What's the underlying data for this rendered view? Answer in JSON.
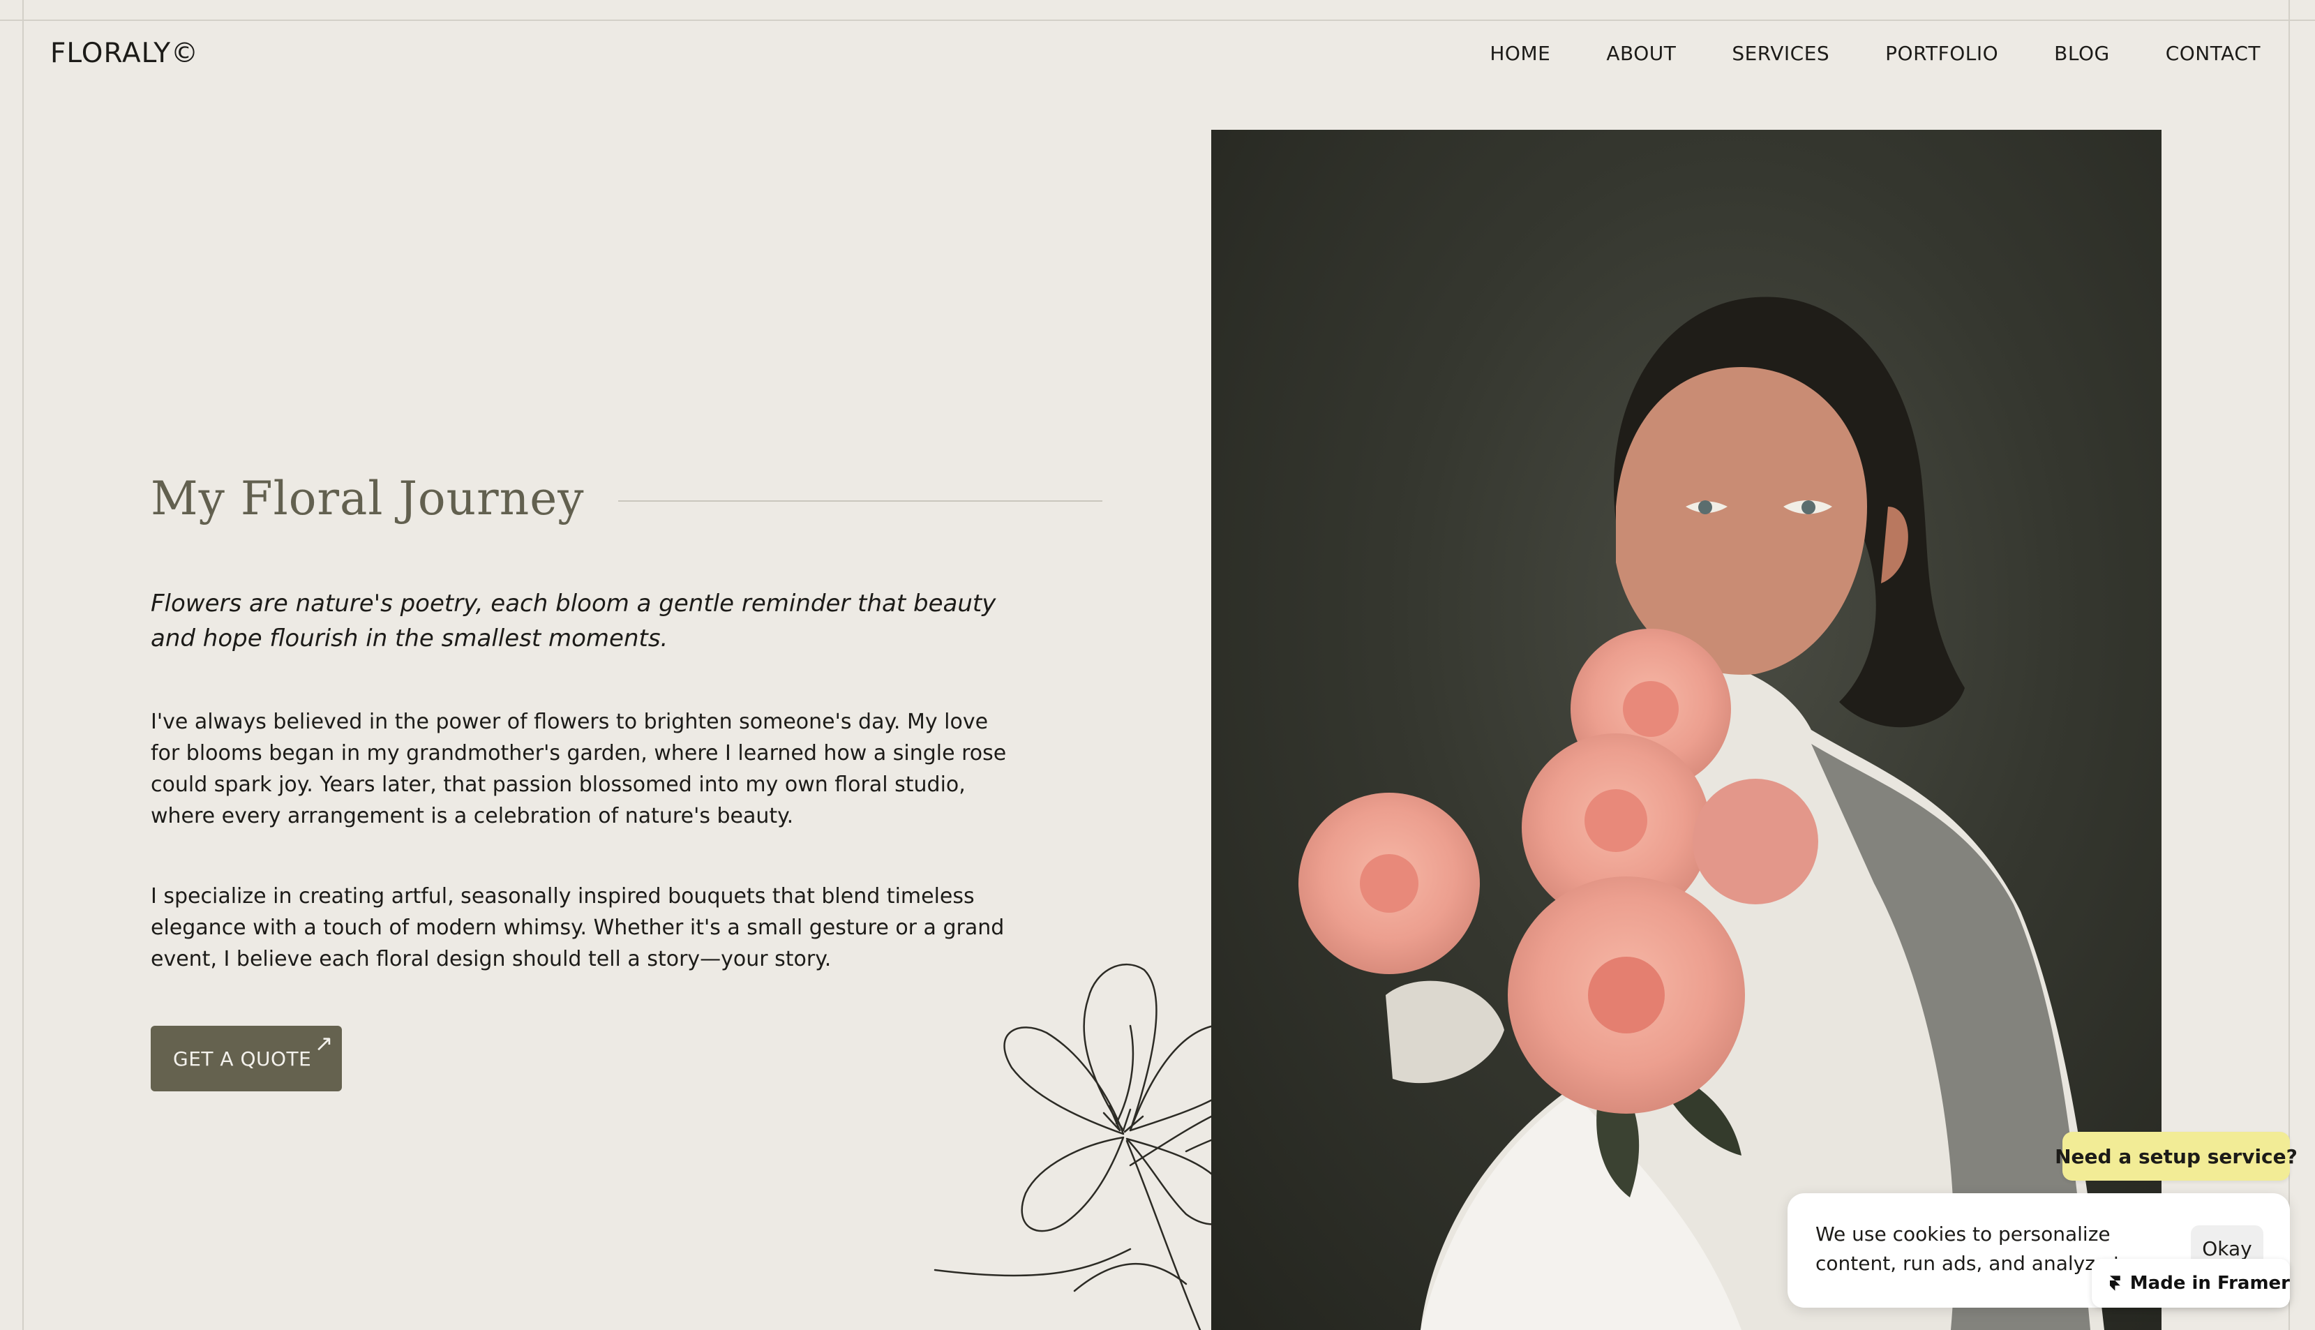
{
  "site": {
    "logo": "FLORALY©"
  },
  "nav": {
    "items": [
      {
        "label": "HOME"
      },
      {
        "label": "ABOUT"
      },
      {
        "label": "SERVICES"
      },
      {
        "label": "PORTFOLIO"
      },
      {
        "label": "BLOG"
      },
      {
        "label": "CONTACT"
      }
    ]
  },
  "hero": {
    "title": "My Floral Journey",
    "quote": "Flowers are nature's poetry, each bloom a gentle reminder that beauty and hope flourish in the smallest moments.",
    "paragraph1": "I've always believed in the power of flowers to brighten someone's day. My love for blooms began in my grandmother's garden, where I learned how a single rose could spark joy. Years later, that passion blossomed into my own floral studio, where every arrangement is a celebration of nature's beauty.",
    "paragraph2": "I specialize in creating artful, seasonally inspired bouquets that blend timeless elegance with a touch of modern whimsy. Whether it's a small gesture or a grand event, I believe each floral design should tell a story—your story.",
    "cta_label": "GET A QUOTE",
    "cta_icon": "arrow-up-right-icon"
  },
  "widgets": {
    "setup_label": "Need a setup service?",
    "cookie_text": "We use cookies to personalize content, run ads, and analyze t",
    "okay_label": "Okay",
    "framer_label": "Made in Framer"
  },
  "colors": {
    "background": "#edeae4",
    "title": "#62604f",
    "button": "#65624f",
    "setup_pill": "#f2ec96",
    "flowers": "#f3a596"
  }
}
